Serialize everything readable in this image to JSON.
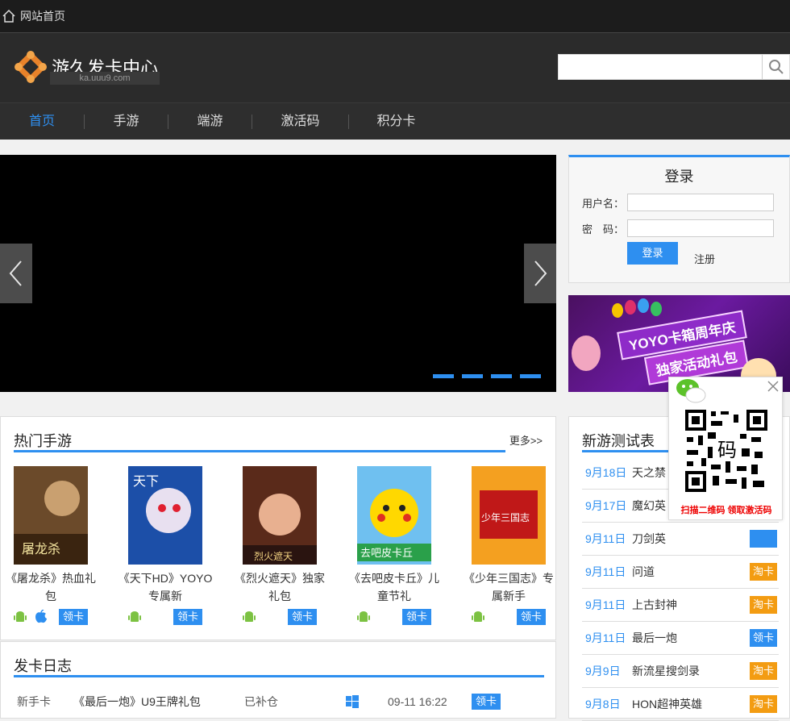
{
  "topbar": {
    "home_label": "网站首页"
  },
  "header": {
    "logo_title": "游久发卡中心",
    "logo_domain": "ka.uuu9.com",
    "search_placeholder": ""
  },
  "nav": {
    "items": [
      "首页",
      "手游",
      "端游",
      "激活码",
      "积分卡"
    ],
    "active_index": 0
  },
  "login": {
    "title": "登录",
    "username_label": "用户名：",
    "password_label": "密　码：",
    "login_button": "登录",
    "register_link": "注册"
  },
  "banner": {
    "line1": "YOYO卡箱周年庆",
    "line2": "独家活动礼包"
  },
  "hot": {
    "title": "热门手游",
    "more": "更多>>",
    "card_button": "领卡",
    "games": [
      {
        "name": "《屠龙杀》热血礼包",
        "android": true,
        "ios": true,
        "cover_text": "屠龙杀"
      },
      {
        "name": "《天下HD》YOYO专属新",
        "android": true,
        "ios": false,
        "cover_text": "天下"
      },
      {
        "name": "《烈火遮天》独家礼包",
        "android": true,
        "ios": false,
        "cover_text": "烈火遮天"
      },
      {
        "name": "《去吧皮卡丘》儿童节礼",
        "android": true,
        "ios": false,
        "cover_text": "去吧皮卡丘"
      },
      {
        "name": "《少年三国志》专属新手",
        "android": true,
        "ios": false,
        "cover_text": "少年三国志"
      }
    ]
  },
  "log": {
    "title": "发卡日志",
    "row": {
      "type": "新手卡",
      "name": "《最后一炮》U9王牌礼包",
      "status": "已补仓",
      "time": "09-11 16:22",
      "button": "领卡"
    }
  },
  "newgames": {
    "title": "新游测试表",
    "rows": [
      {
        "date": "9月18日",
        "name": "天之禁",
        "tag": "",
        "color": ""
      },
      {
        "date": "9月17日",
        "name": "魔幻英",
        "tag": "",
        "color": ""
      },
      {
        "date": "9月11日",
        "name": "刀剑英",
        "tag": "",
        "color": ""
      },
      {
        "date": "9月11日",
        "name": "问道",
        "tag": "淘卡",
        "color": "orange"
      },
      {
        "date": "9月11日",
        "name": "上古封神",
        "tag": "淘卡",
        "color": "orange"
      },
      {
        "date": "9月11日",
        "name": "最后一炮",
        "tag": "领卡",
        "color": "blue"
      },
      {
        "date": "9月9日",
        "name": "新流星搜剑录",
        "tag": "淘卡",
        "color": "orange"
      },
      {
        "date": "9月8日",
        "name": "HON超神英雄",
        "tag": "淘卡",
        "color": "orange"
      }
    ]
  },
  "qr": {
    "caption": "扫描二维码 领取激活码",
    "qr_word": "码"
  },
  "colors": {
    "accent": "#2e8ff0",
    "orange": "#f39c12",
    "dark": "#2b2b2b"
  }
}
